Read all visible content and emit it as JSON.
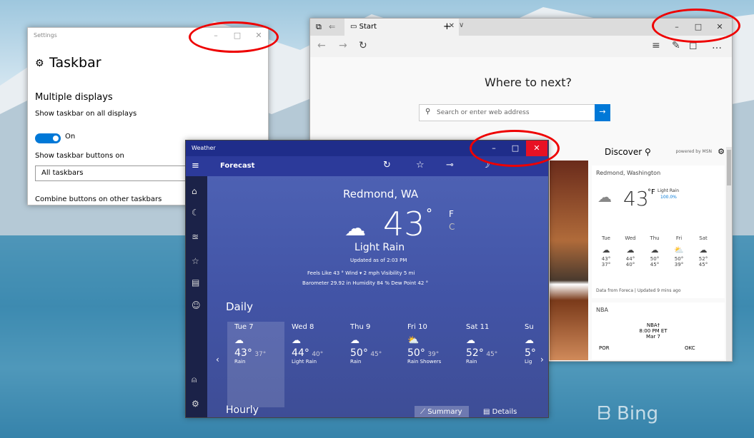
{
  "settings": {
    "title": "Settings",
    "heading": "Taskbar",
    "section": "Multiple displays",
    "show_all_label": "Show taskbar on all displays",
    "toggle_state": "On",
    "buttons_label": "Show taskbar buttons on",
    "dropdown_value": "All taskbars",
    "combine_label": "Combine buttons on other taskbars"
  },
  "edge": {
    "tab_title": "Start",
    "headline": "Where to next?",
    "search_placeholder": "Search or enter web address",
    "discover": "Discover",
    "powered": "powered by MSN",
    "weather_card": {
      "location": "Redmond, Washington",
      "temp": "43",
      "unit": "°F",
      "cond": "Light Rain",
      "precip": "100.0%",
      "footer": "Data from Foreca | Updated 9 mins ago",
      "days": [
        {
          "d": "Tue",
          "hi": "43°",
          "lo": "37°"
        },
        {
          "d": "Wed",
          "hi": "44°",
          "lo": "40°"
        },
        {
          "d": "Thu",
          "hi": "50°",
          "lo": "45°"
        },
        {
          "d": "Fri",
          "hi": "50°",
          "lo": "39°"
        },
        {
          "d": "Sat",
          "hi": "52°",
          "lo": "45°"
        }
      ]
    },
    "nba": {
      "title": "NBA",
      "game": "NBA†",
      "time": "8:00 PM ET",
      "date": "Mar 7",
      "team1": "POR",
      "team2": "OKC"
    }
  },
  "weather": {
    "title": "Weather",
    "tab": "Forecast",
    "city": "Redmond, WA",
    "temp": "43",
    "deg": "°",
    "f": "F",
    "c": "C",
    "cond": "Light Rain",
    "updated": "Updated as of 2:03 PM",
    "details1": "Feels Like  43 °     Wind  ▾ 2 mph     Visibility  5 mi",
    "details2": "Barometer  29.92 in     Humidity  84 %     Dew Point  42 °",
    "daily_label": "Daily",
    "hourly_label": "Hourly",
    "summary": "Summary",
    "details_btn": "Details",
    "days": [
      {
        "name": "Tue 7",
        "hi": "43°",
        "lo": "37°",
        "cond": "Rain"
      },
      {
        "name": "Wed 8",
        "hi": "44°",
        "lo": "40°",
        "cond": "Light Rain"
      },
      {
        "name": "Thu 9",
        "hi": "50°",
        "lo": "45°",
        "cond": "Rain"
      },
      {
        "name": "Fri 10",
        "hi": "50°",
        "lo": "39°",
        "cond": "Rain Showers"
      },
      {
        "name": "Sat 11",
        "hi": "52°",
        "lo": "45°",
        "cond": "Rain"
      },
      {
        "name": "Su",
        "hi": "5°",
        "lo": "",
        "cond": "Lig"
      }
    ]
  },
  "desktop": {
    "bing": "Bing"
  },
  "colors": {
    "accent": "#0078d7",
    "close": "#e81123",
    "annotation": "#e00000"
  }
}
